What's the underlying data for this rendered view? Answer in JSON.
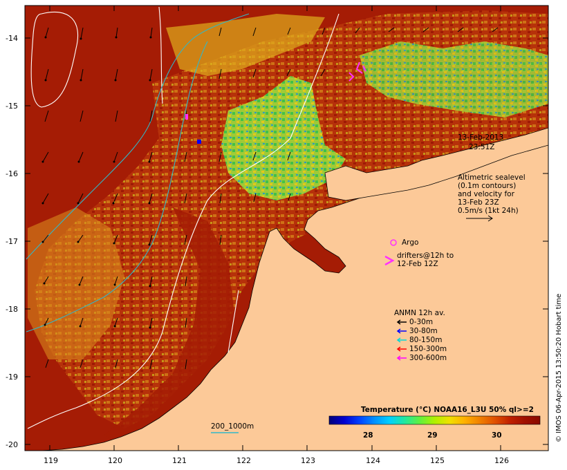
{
  "map": {
    "lon_ticks": [
      "119",
      "120",
      "121",
      "122",
      "123",
      "124",
      "125",
      "126"
    ],
    "lat_ticks": [
      "-14",
      "-15",
      "-16",
      "-17",
      "-18",
      "-19",
      "-20"
    ],
    "timestamp_date": "13-Feb-2013",
    "timestamp_time": "23:51Z",
    "sealevel_note": [
      "Altimetric sealevel",
      "(0.1m contours)",
      "and velocity for",
      "13-Feb 23Z",
      "0.5m/s (1kt 24h)"
    ],
    "argo_label": "Argo",
    "drifters_label": [
      "drifters@12h to",
      "12-Feb 12Z"
    ],
    "anmn_title": "ANMN 12h av.",
    "anmn_items": [
      {
        "label": "0-30m",
        "color": "#000000"
      },
      {
        "label": "30-80m",
        "color": "#0000ff"
      },
      {
        "label": "80-150m",
        "color": "#00d8d8"
      },
      {
        "label": "150-300m",
        "color": "#ff0000"
      },
      {
        "label": "300-600m",
        "color": "#ff00ff"
      }
    ],
    "depth_contour_label": "200_1000m",
    "credit": "© IMOS 06-Apr-2015 13:50:20 Hobart time",
    "colorbar": {
      "title": "Temperature (°C) NOAA16_L3U 50% ql>=2",
      "ticks": [
        "28",
        "29",
        "30"
      ],
      "colors": [
        "#00007a",
        "#0000d0",
        "#0040ff",
        "#0090ff",
        "#00d0ff",
        "#20e8a0",
        "#60f040",
        "#b0f000",
        "#f0e000",
        "#ffb000",
        "#f08000",
        "#e05000",
        "#c02000",
        "#a01000",
        "#8a0a00"
      ]
    },
    "palette": {
      "ocean_warm": "#a51c05",
      "land": "#fcc998",
      "green": "#4fd13b",
      "yellow": "#e0c418",
      "orange": "#d8881c",
      "contour": "#ffffff",
      "isobath": "#30b8c8"
    }
  }
}
